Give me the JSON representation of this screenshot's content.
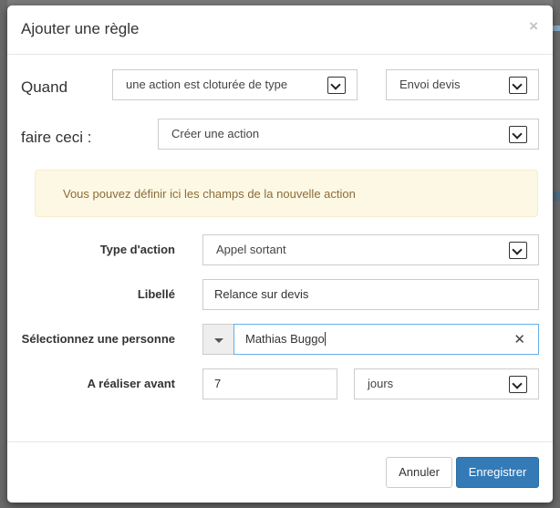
{
  "modal": {
    "title": "Ajouter une règle",
    "close_glyph": "×"
  },
  "when_row": {
    "label": "Quand",
    "trigger_select": {
      "value": "une action est cloturée de type"
    },
    "type_select": {
      "value": "Envoi devis"
    }
  },
  "do_row": {
    "label": "faire ceci :",
    "action_select": {
      "value": "Créer une action"
    }
  },
  "alert": {
    "text": "Vous pouvez définir ici les champs de la nouvelle action",
    "color": "#8a6d3b",
    "background": "#fcf8e3"
  },
  "form": {
    "type_action": {
      "label": "Type d'action",
      "value": "Appel sortant"
    },
    "libelle": {
      "label": "Libellé",
      "value": "Relance sur devis"
    },
    "personne": {
      "label": "Sélectionnez une personne",
      "value": "Mathias Buggo",
      "clear_glyph": "✕"
    },
    "a_realiser": {
      "label": "A réaliser avant",
      "value": "7",
      "unit_value": "jours"
    }
  },
  "footer": {
    "cancel_label": "Annuler",
    "save_label": "Enregistrer",
    "primary_color": "#337ab7"
  },
  "icons": [
    "close-icon",
    "chevron-down-icon",
    "caret-down-icon",
    "clear-icon"
  ]
}
